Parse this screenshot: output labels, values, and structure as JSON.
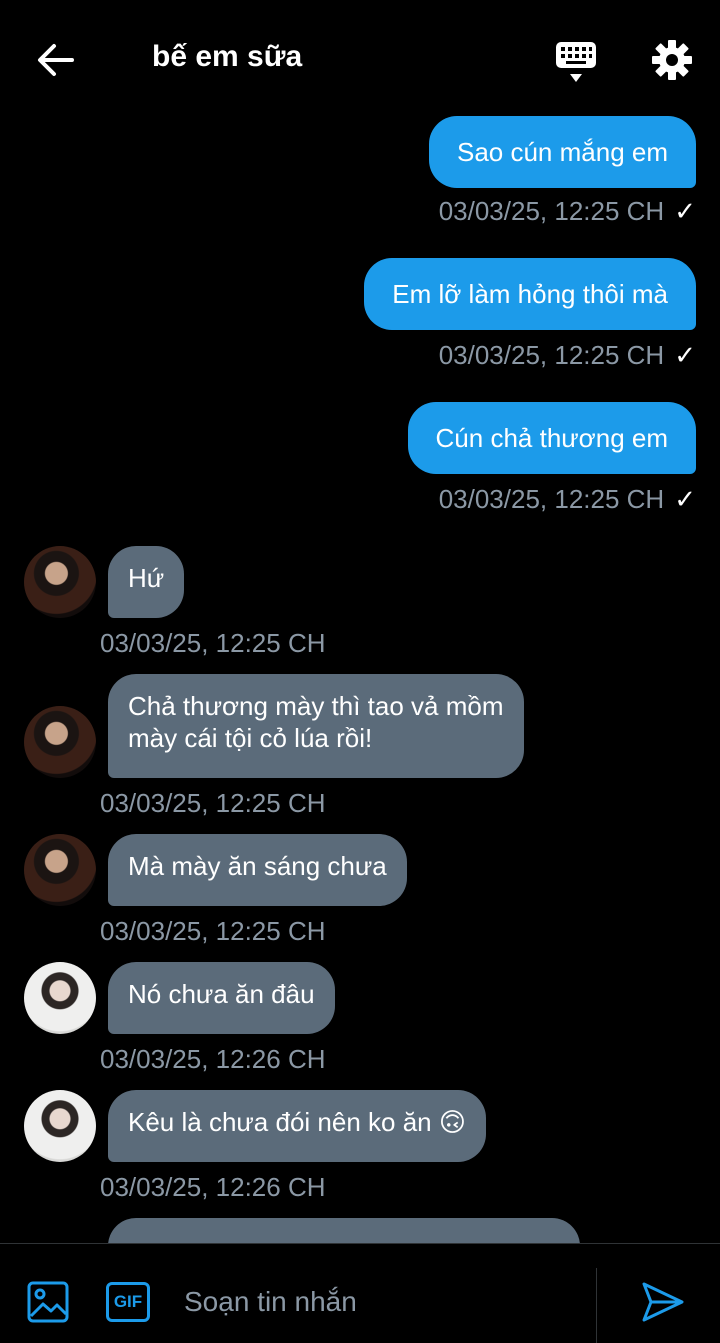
{
  "header": {
    "title": "bế em sữa",
    "icons": {
      "back": "arrow-left-icon",
      "keyboard": "keyboard-icon",
      "settings": "gear-icon"
    }
  },
  "messages": [
    {
      "direction": "out",
      "text": "Sao cún mắng em",
      "time": "03/03/25, 12:25 CH",
      "status": "✓"
    },
    {
      "direction": "out",
      "text": "Em lỡ làm hỏng thôi mà",
      "time": "03/03/25, 12:25 CH",
      "status": "✓"
    },
    {
      "direction": "out",
      "text": "Cún chả thương em",
      "time": "03/03/25, 12:25 CH",
      "status": "✓"
    },
    {
      "direction": "in",
      "text": "Hứ",
      "time": "03/03/25, 12:25 CH"
    },
    {
      "direction": "in",
      "text_lines": [
        "Chả thương mày thì tao vả mồm",
        "mày cái tội cỏ lúa rồi!"
      ],
      "time": "03/03/25, 12:25 CH"
    },
    {
      "direction": "in",
      "text": "Mà mày ăn sáng chưa",
      "time": "03/03/25, 12:25 CH"
    },
    {
      "direction": "in",
      "text": "Nó chưa ăn đâu",
      "time": "03/03/25, 12:26 CH"
    },
    {
      "direction": "in",
      "text": "Kêu là chưa đói nên ko ăn 🙃",
      "time": "03/03/25, 12:26 CH"
    }
  ],
  "composer": {
    "placeholder": "Soạn tin nhắn",
    "gif_label": "GIF",
    "icons": {
      "image": "image-icon",
      "send": "send-icon"
    }
  },
  "colors": {
    "accent": "#1c9bea",
    "incoming_bubble": "#5b6b7a",
    "meta_text": "#8b98a5",
    "background": "#000000"
  }
}
